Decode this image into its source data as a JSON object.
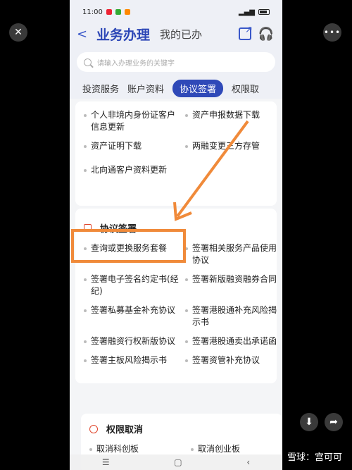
{
  "statusbar": {
    "time": "11:00"
  },
  "nav": {
    "back": "<",
    "title": "业务办理",
    "subtitle": "我的已办"
  },
  "search": {
    "placeholder": "请输入办理业务的关键字"
  },
  "tabs": [
    "投资服务",
    "账户资料",
    "协议签署",
    "权限取"
  ],
  "card1": {
    "items": [
      "个人非境内身份证客户信息更新",
      "资产申报数据下载",
      "资产证明下载",
      "两融变更三方存管",
      "北向通客户资料更新"
    ]
  },
  "agreement": {
    "title": "协议签署",
    "items": [
      "查询或更换服务套餐",
      "签署相关服务产品使用协议",
      "签署电子签名约定书(经纪)",
      "签署新版融资融券合同",
      "签署私募基金补充协议",
      "签署港股通补充风险揭示书",
      "签署融资行权新版协议",
      "签署港股通卖出承诺函",
      "签署主板风险揭示书",
      "签署资管补充协议"
    ]
  },
  "revoke": {
    "title": "权限取消",
    "items": [
      "取消科创板",
      "取消创业板"
    ]
  },
  "watermark": "雪球：宫可可",
  "colors": {
    "brand": "#2f49b8",
    "highlight": "#f08a3a"
  }
}
